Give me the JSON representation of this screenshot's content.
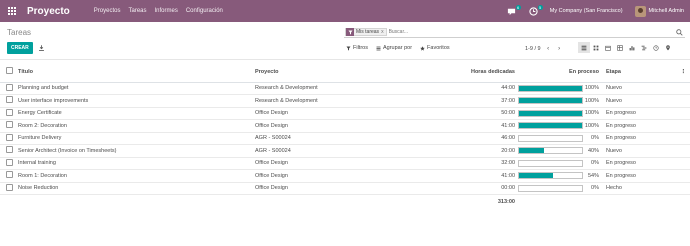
{
  "navbar": {
    "brand": "Proyecto",
    "menu": [
      "Proyectos",
      "Tareas",
      "Informes",
      "Configuración"
    ],
    "chat_badge": "6",
    "activity_badge": "5",
    "company": "My Company (San Francisco)",
    "user": "Mitchell Admin"
  },
  "control": {
    "title": "Tareas",
    "create_label": "CREAR",
    "facet_value": "Mis tareas",
    "facet_close": "x",
    "search_placeholder": "Buscar...",
    "filters_label": "Filtros",
    "group_label": "Agrupar por",
    "favorites_label": "Favoritos",
    "pager": "1-9 / 9"
  },
  "table": {
    "headers": {
      "title": "Título",
      "project": "Proyecto",
      "hours": "Horas dedicadas",
      "progress": "En proceso",
      "stage": "Etapa"
    },
    "rows": [
      {
        "title": "Planning and budget",
        "project": "Research & Development",
        "hours": "44:00",
        "progress": 100,
        "progress_label": "100%",
        "stage": "Nuevo"
      },
      {
        "title": "User interface improvements",
        "project": "Research & Development",
        "hours": "37:00",
        "progress": 100,
        "progress_label": "100%",
        "stage": "Nuevo"
      },
      {
        "title": "Energy Certificate",
        "project": "Office Design",
        "hours": "50:00",
        "progress": 100,
        "progress_label": "100%",
        "stage": "En progreso"
      },
      {
        "title": "Room 2: Decoration",
        "project": "Office Design",
        "hours": "41:00",
        "progress": 100,
        "progress_label": "100%",
        "stage": "En progreso"
      },
      {
        "title": "Furniture Delivery",
        "project": "AGR - S00024",
        "hours": "46:00",
        "progress": 0,
        "progress_label": "0%",
        "stage": "En progreso"
      },
      {
        "title": "Senior Architect (Invoice on Timesheets)",
        "project": "AGR - S00024",
        "hours": "20:00",
        "progress": 40,
        "progress_label": "40%",
        "stage": "Nuevo"
      },
      {
        "title": "Internal training",
        "project": "Office Design",
        "hours": "32:00",
        "progress": 0,
        "progress_label": "0%",
        "stage": "En progreso"
      },
      {
        "title": "Room 1: Decoration",
        "project": "Office Design",
        "hours": "41:00",
        "progress": 54,
        "progress_label": "54%",
        "stage": "En progreso"
      },
      {
        "title": "Noise Reduction",
        "project": "Office Design",
        "hours": "00:00",
        "progress": 0,
        "progress_label": "0%",
        "stage": "Hecho"
      }
    ],
    "total_hours": "313:00"
  },
  "colors": {
    "navbar": "#875a7b",
    "accent": "#00a09d"
  }
}
